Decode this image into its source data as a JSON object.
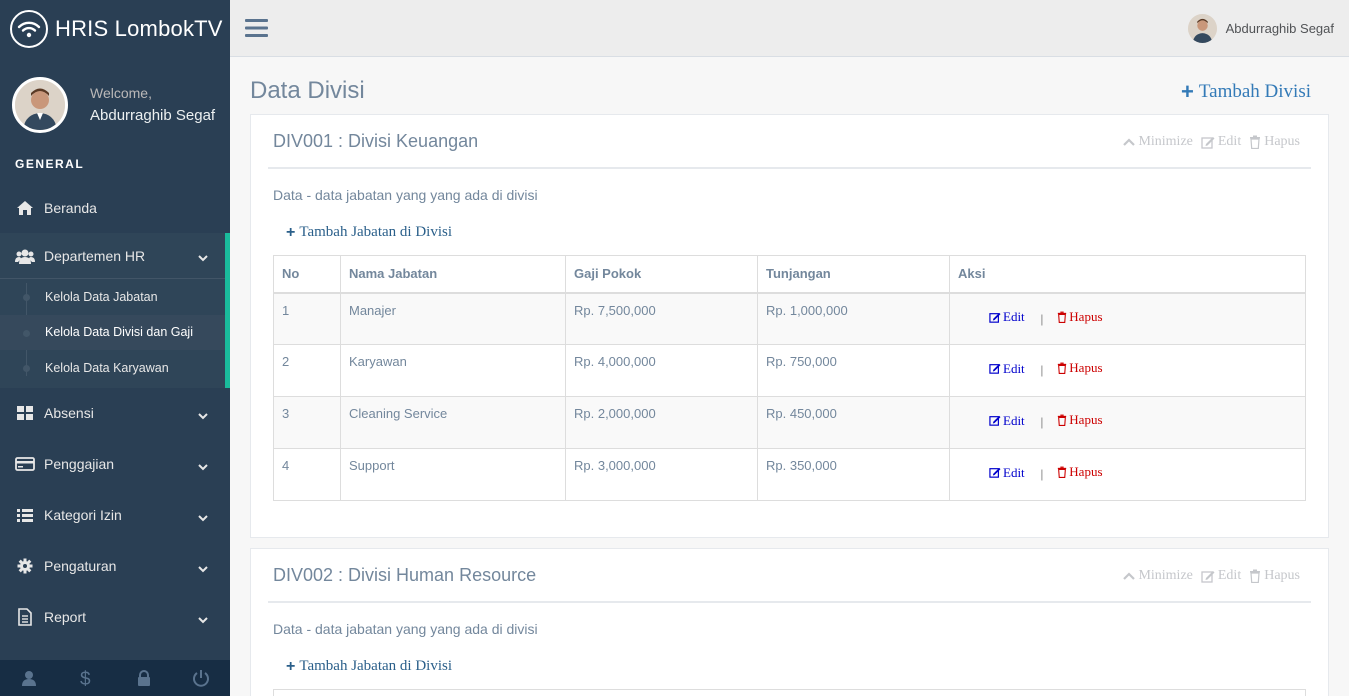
{
  "brand": {
    "title": "HRIS LombokTV"
  },
  "profile": {
    "welcome": "Welcome,",
    "name": "Abdurraghib Segaf"
  },
  "sidebar": {
    "section": "GENERAL",
    "items": [
      {
        "label": "Beranda",
        "icon": "home-icon"
      },
      {
        "label": "Departemen HR",
        "icon": "users-icon"
      },
      {
        "label": "Absensi",
        "icon": "grid-icon"
      },
      {
        "label": "Penggajian",
        "icon": "credit-card-icon"
      },
      {
        "label": "Kategori Izin",
        "icon": "list-icon"
      },
      {
        "label": "Pengaturan",
        "icon": "gear-icon"
      },
      {
        "label": "Report",
        "icon": "document-icon"
      }
    ],
    "submenu": [
      {
        "label": "Kelola Data Jabatan"
      },
      {
        "label": "Kelola Data Divisi dan Gaji"
      },
      {
        "label": "Kelola Data Karyawan"
      }
    ],
    "accent_color": "#1abb9c"
  },
  "topnav": {
    "user_name": "Abdurraghib Segaf"
  },
  "page": {
    "title": "Data Divisi",
    "add_label": "Tambah Divisi"
  },
  "tools": {
    "minimize": "Minimize",
    "edit": "Edit",
    "delete": "Hapus"
  },
  "divisions": [
    {
      "title": "DIV001 : Divisi Keuangan",
      "desc": "Data - data jabatan yang yang ada di divisi",
      "add_label": "Tambah Jabatan di Divisi",
      "headers": [
        "No",
        "Nama Jabatan",
        "Gaji Pokok",
        "Tunjangan",
        "Aksi"
      ],
      "rows": [
        {
          "no": "1",
          "nama": "Manajer",
          "gaji": "Rp. 7,500,000",
          "tunjangan": "Rp. 1,000,000"
        },
        {
          "no": "2",
          "nama": "Karyawan",
          "gaji": "Rp. 4,000,000",
          "tunjangan": "Rp. 750,000"
        },
        {
          "no": "3",
          "nama": "Cleaning Service",
          "gaji": "Rp. 2,000,000",
          "tunjangan": "Rp. 450,000"
        },
        {
          "no": "4",
          "nama": "Support",
          "gaji": "Rp. 3,000,000",
          "tunjangan": "Rp. 350,000"
        }
      ],
      "actions": {
        "edit": "Edit",
        "sep": "|",
        "delete": "Hapus"
      }
    },
    {
      "title": "DIV002 : Divisi Human Resource",
      "desc": "Data - data jabatan yang yang ada di divisi",
      "add_label": "Tambah Jabatan di Divisi"
    }
  ],
  "colors": {
    "sidebar": "#2a3f54",
    "link": "#337ab7",
    "delete": "#cc0000",
    "edit": "#0000cc"
  }
}
